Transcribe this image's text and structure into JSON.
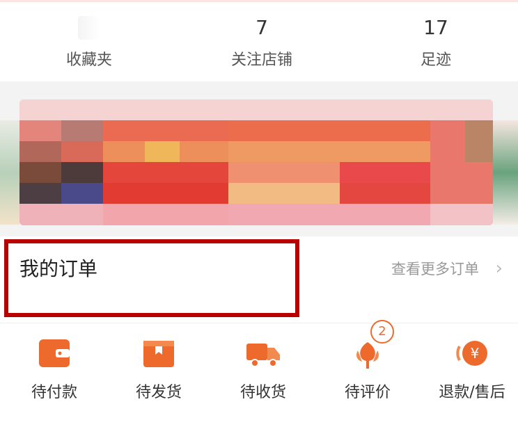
{
  "stats": [
    {
      "value": "",
      "label": "收藏夹"
    },
    {
      "value": "7",
      "label": "关注店铺"
    },
    {
      "value": "17",
      "label": "足迹"
    }
  ],
  "orders": {
    "title": "我的订单",
    "more_label": "查看更多订单",
    "chevron": "›",
    "items": [
      {
        "label": "待付款",
        "icon": "wallet-icon"
      },
      {
        "label": "待发货",
        "icon": "box-icon"
      },
      {
        "label": "待收货",
        "icon": "truck-icon"
      },
      {
        "label": "待评价",
        "icon": "flower-icon",
        "badge": "2"
      },
      {
        "label": "退款/售后",
        "icon": "refund-yen-icon"
      }
    ]
  },
  "colors": {
    "accent": "#ee6a2c",
    "highlight_border": "#b80000"
  }
}
